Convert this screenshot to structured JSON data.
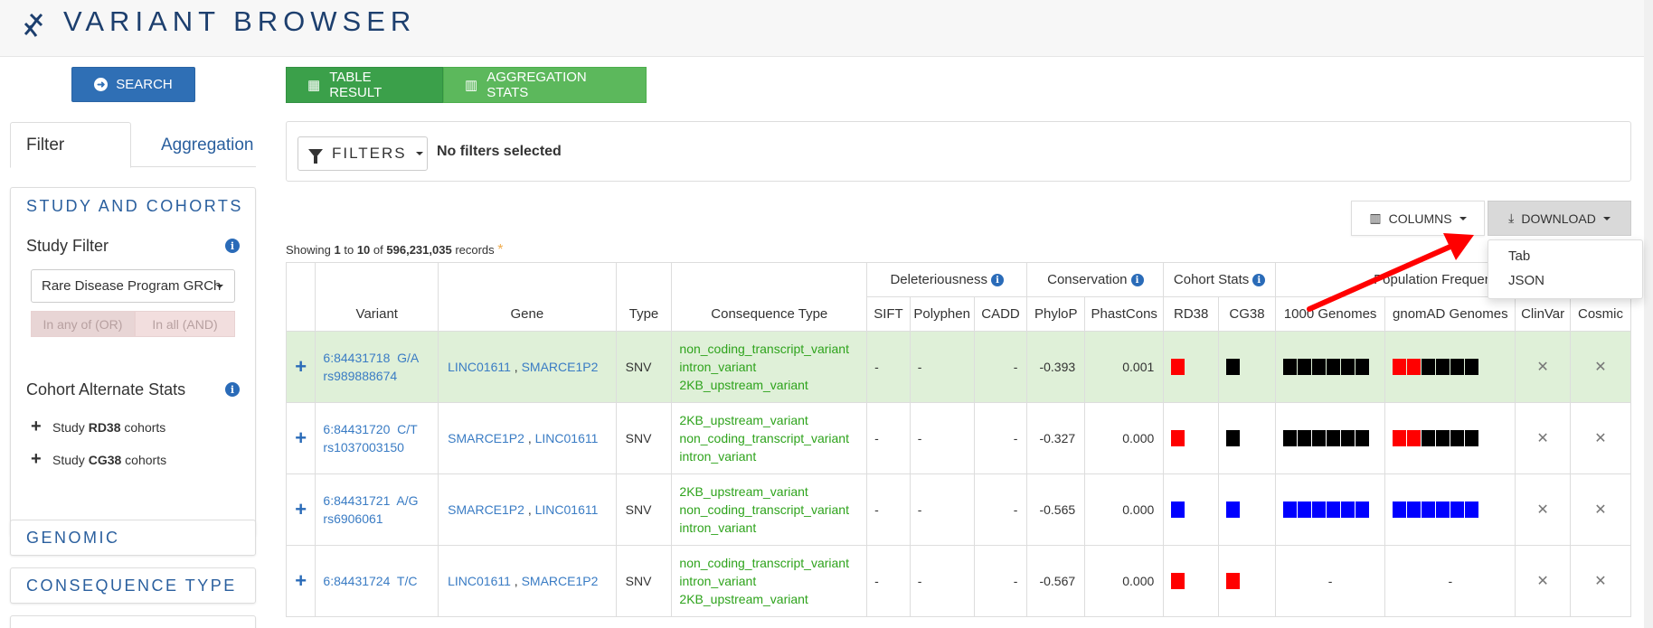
{
  "app": {
    "title": "VARIANT BROWSER",
    "logo_icon": "dna-icon"
  },
  "sidebar": {
    "search_label": "SEARCH",
    "tabs": [
      {
        "label": "Filter",
        "active": true
      },
      {
        "label": "Aggregation",
        "active": false
      }
    ],
    "study_panel": {
      "title": "STUDY AND COHORTS",
      "study_filter_label": "Study Filter",
      "study_select_value": "Rare Disease Program GRCh",
      "toggle_or": "In any of (OR)",
      "toggle_and": "In all (AND)",
      "cohort_stats_label": "Cohort Alternate Stats",
      "cohorts": [
        {
          "prefix": "Study",
          "name": "RD38",
          "suffix": "cohorts"
        },
        {
          "prefix": "Study",
          "name": "CG38",
          "suffix": "cohorts"
        }
      ]
    },
    "genomic_title": "GENOMIC",
    "consequence_title": "CONSEQUENCE TYPE"
  },
  "main": {
    "view_tabs": {
      "table": "TABLE RESULT",
      "aggregation": "AGGREGATION STATS"
    },
    "filters_label": "FILTERS",
    "no_filters": "No filters selected",
    "columns_label": "COLUMNS",
    "download_label": "DOWNLOAD",
    "download_options": [
      "Tab",
      "JSON"
    ],
    "showing": {
      "prefix": "Showing",
      "from": "1",
      "to_word": "to",
      "to": "10",
      "of_word": "of",
      "total": "596,231,035",
      "suffix": "records",
      "asterisk": "*"
    }
  },
  "table": {
    "group_headers": {
      "deleteriousness": "Deleteriousness",
      "conservation": "Conservation",
      "cohort_stats": "Cohort Stats",
      "population_frequencies": "Population Frequencies"
    },
    "columns": [
      "Variant",
      "Gene",
      "Type",
      "Consequence Type",
      "SIFT",
      "Polyphen",
      "CADD",
      "PhyloP",
      "PhastCons",
      "RD38",
      "CG38",
      "1000 Genomes",
      "gnomAD Genomes",
      "ClinVar",
      "Cosmic"
    ],
    "rows": [
      {
        "variant": "6:84431718  G/A",
        "id": "rs989888674",
        "genes": [
          "LINC01611",
          "SMARCE1P2"
        ],
        "type": "SNV",
        "consequences": [
          "non_coding_transcript_variant",
          "intron_variant",
          "2KB_upstream_variant"
        ],
        "sift": "-",
        "polyphen": "-",
        "cadd": "-",
        "phylop": "-0.393",
        "phastcons": "0.001",
        "rd38": "#ff0000",
        "cg38": "#000000",
        "g1000": [
          "#000000",
          "#000000",
          "#000000",
          "#000000",
          "#000000",
          "#000000"
        ],
        "gnomad": [
          "#ff0000",
          "#ff0000",
          "#000000",
          "#000000",
          "#000000",
          "#000000"
        ],
        "clinvar": "✕",
        "cosmic": "✕"
      },
      {
        "variant": "6:84431720  C/T",
        "id": "rs1037003150",
        "genes": [
          "SMARCE1P2",
          "LINC01611"
        ],
        "type": "SNV",
        "consequences": [
          "2KB_upstream_variant",
          "non_coding_transcript_variant",
          "intron_variant"
        ],
        "sift": "-",
        "polyphen": "-",
        "cadd": "-",
        "phylop": "-0.327",
        "phastcons": "0.000",
        "rd38": "#ff0000",
        "cg38": "#000000",
        "g1000": [
          "#000000",
          "#000000",
          "#000000",
          "#000000",
          "#000000",
          "#000000"
        ],
        "gnomad": [
          "#ff0000",
          "#ff0000",
          "#000000",
          "#000000",
          "#000000",
          "#000000"
        ],
        "clinvar": "✕",
        "cosmic": "✕"
      },
      {
        "variant": "6:84431721  A/G",
        "id": "rs6906061",
        "genes": [
          "SMARCE1P2",
          "LINC01611"
        ],
        "type": "SNV",
        "consequences": [
          "2KB_upstream_variant",
          "non_coding_transcript_variant",
          "intron_variant"
        ],
        "sift": "-",
        "polyphen": "-",
        "cadd": "-",
        "phylop": "-0.565",
        "phastcons": "0.000",
        "rd38": "#0000ff",
        "cg38": "#0000ff",
        "g1000": [
          "#0000ff",
          "#0000ff",
          "#0000ff",
          "#0000ff",
          "#0000ff",
          "#0000ff"
        ],
        "gnomad": [
          "#0000ff",
          "#0000ff",
          "#0000ff",
          "#0000ff",
          "#0000ff",
          "#0000ff"
        ],
        "clinvar": "✕",
        "cosmic": "✕"
      },
      {
        "variant": "6:84431724  T/C",
        "id": "",
        "genes": [
          "LINC01611",
          "SMARCE1P2"
        ],
        "type": "SNV",
        "consequences": [
          "non_coding_transcript_variant",
          "intron_variant",
          "2KB_upstream_variant"
        ],
        "sift": "-",
        "polyphen": "-",
        "cadd": "-",
        "phylop": "-0.567",
        "phastcons": "0.000",
        "rd38": "#ff0000",
        "cg38": "#ff0000",
        "g1000_text": "-",
        "gnomad_text": "-",
        "clinvar": "✕",
        "cosmic": "✕"
      }
    ]
  },
  "colors": {
    "primary": "#2f6fb5",
    "tab_green": "#3ba04a",
    "tab_green_light": "#5cb85c",
    "row_highlight": "#dff0d8",
    "consequence_text": "#2ea31c",
    "arrow": "#ff0000"
  }
}
